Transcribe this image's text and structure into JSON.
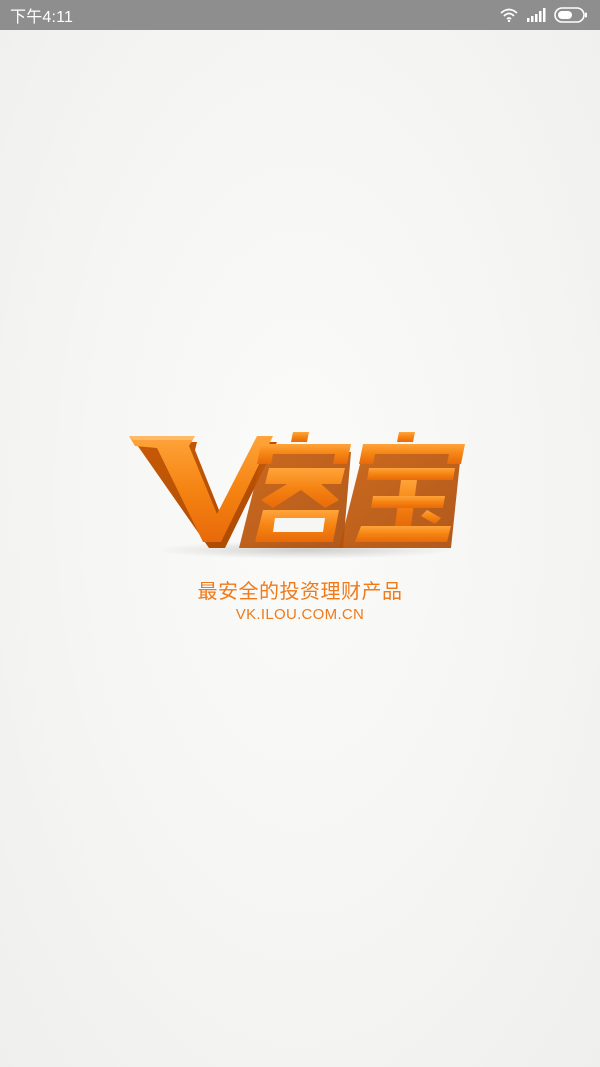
{
  "status_bar": {
    "time": "下午4:11",
    "icons": [
      "wifi-icon",
      "signal-icon",
      "battery-icon"
    ]
  },
  "splash": {
    "logo_alt": "V客宝",
    "slogan": "最安全的投资理财产品",
    "website": "VK.ILOU.COM.CN"
  },
  "colors": {
    "brand_orange": "#f07a1a",
    "status_bar": "#8e8e8e",
    "background": "#f6f6f4"
  }
}
